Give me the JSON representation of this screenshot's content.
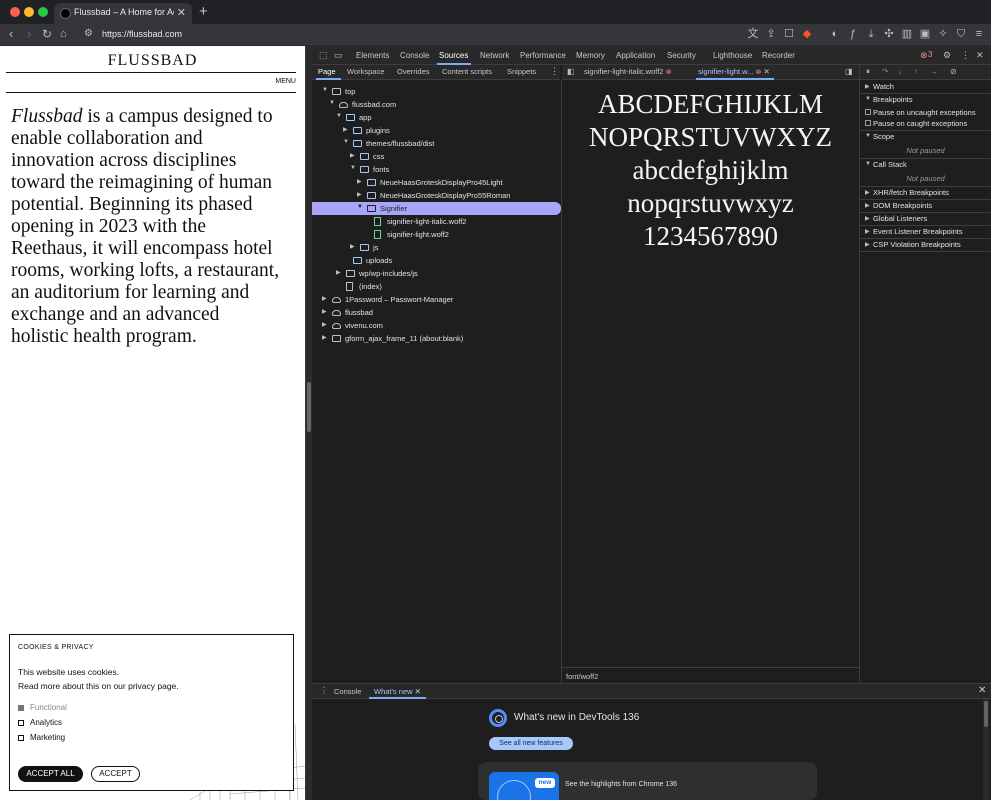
{
  "browser": {
    "tab_title": "Flussbad – A Home for Adventurous Minds",
    "tab_close": "✕",
    "new_tab": "+",
    "url": "https://flussbad.com",
    "icons": [
      "back-icon",
      "forward-icon",
      "reload-icon",
      "home-icon",
      "site-settings-icon",
      "translate-icon",
      "share-icon",
      "bookmark-icon",
      "brave-shields-icon",
      "rewards-icon",
      "font-icon",
      "download-icon",
      "extensions-icon",
      "sidebar-icon",
      "wallet-icon",
      "leo-icon",
      "vpn-icon",
      "menu-icon"
    ]
  },
  "site": {
    "logo": "FLUSSBAD",
    "menu": "MENU",
    "intro_emphasis": "Flussbad",
    "intro_rest": " is a campus designed to enable collaboration and innovation across disciplines toward the reimagining of human potential. Beginning its phased opening in 2023 with the Reethaus, it will encompass hotel rooms, working lofts, a restaurant, an auditorium for learning and exchange and an advanced holistic health program."
  },
  "cookies": {
    "title": "COOKIES & PRIVACY",
    "line1": "This website uses cookies.",
    "line2": "Read more about this on our privacy page.",
    "options": [
      {
        "label": "Functional",
        "checked": true,
        "disabled": true
      },
      {
        "label": "Analytics",
        "checked": false,
        "disabled": false
      },
      {
        "label": "Marketing",
        "checked": false,
        "disabled": false
      }
    ],
    "accept_all": "ACCEPT ALL",
    "accept": "ACCEPT"
  },
  "devtools": {
    "tabs": [
      "Elements",
      "Console",
      "Sources",
      "Network",
      "Performance",
      "Memory",
      "Application",
      "Security",
      "Lighthouse",
      "Recorder"
    ],
    "active_tab": "Sources",
    "error_count": "3",
    "sub_tabs": [
      "Page",
      "Workspace",
      "Overrides",
      "Content scripts",
      "Snippets"
    ],
    "tree": [
      {
        "label": "top",
        "icon": "frame",
        "arrow": "▼"
      },
      {
        "label": "flussbad.com",
        "icon": "cloud",
        "arrow": "▼"
      },
      {
        "label": "app",
        "icon": "folder",
        "arrow": "▼"
      },
      {
        "label": "plugins",
        "icon": "folder",
        "arrow": "▶"
      },
      {
        "label": "themes/flussbad/dist",
        "icon": "folder",
        "arrow": "▼"
      },
      {
        "label": "css",
        "icon": "folder",
        "arrow": "▶"
      },
      {
        "label": "fonts",
        "icon": "folder",
        "arrow": "▼"
      },
      {
        "label": "NeueHaasGroteskDisplayPro45Light",
        "icon": "folder",
        "arrow": "▶"
      },
      {
        "label": "NeueHaasGroteskDisplayPro55Roman",
        "icon": "folder",
        "arrow": "▶"
      },
      {
        "label": "Signifier",
        "icon": "folder",
        "arrow": "▼"
      },
      {
        "label": "signifier-light-italic.woff2",
        "icon": "font",
        "arrow": ""
      },
      {
        "label": "signifier-light.woff2",
        "icon": "font",
        "arrow": ""
      },
      {
        "label": "js",
        "icon": "folder",
        "arrow": "▶"
      },
      {
        "label": "uploads",
        "icon": "folder",
        "arrow": ""
      },
      {
        "label": "wp/wp-includes/js",
        "icon": "folder",
        "arrow": "▶"
      },
      {
        "label": "(index)",
        "icon": "file",
        "arrow": ""
      },
      {
        "label": "1Password – Passwort-Manager",
        "icon": "cloud",
        "arrow": "▶"
      },
      {
        "label": "flussbad",
        "icon": "cloud",
        "arrow": "▶"
      },
      {
        "label": "vivenu.com",
        "icon": "cloud",
        "arrow": "▶"
      },
      {
        "label": "gform_ajax_frame_11 (about:blank)",
        "icon": "frame",
        "arrow": "▶"
      }
    ],
    "editor_tabs": [
      {
        "label": "signifier-light-italic.woff2",
        "active": false
      },
      {
        "label": "signifier-light.w...",
        "active": true
      }
    ],
    "preview_lines": [
      "ABCDEFGHIJKLM",
      "NOPQRSTUVWXYZ",
      "abcdefghijklm",
      "nopqrstuvwxyz",
      "1234567890"
    ],
    "status": "font/woff2",
    "debugger": {
      "watch": "Watch",
      "breakpoints": "Breakpoints",
      "pause_uncaught": "Pause on uncaught exceptions",
      "pause_caught": "Pause on caught exceptions",
      "scope": "Scope",
      "not_paused": "Not paused",
      "call_stack": "Call Stack",
      "sections": [
        "XHR/fetch Breakpoints",
        "DOM Breakpoints",
        "Global Listeners",
        "Event Listener Breakpoints",
        "CSP Violation Breakpoints"
      ]
    },
    "drawer": {
      "tabs": [
        "Console",
        "What's new"
      ],
      "title": "What's new in DevTools 136",
      "see_all": "See all new features",
      "badge": "new",
      "highlight": "See the highlights from Chrome 136"
    }
  }
}
